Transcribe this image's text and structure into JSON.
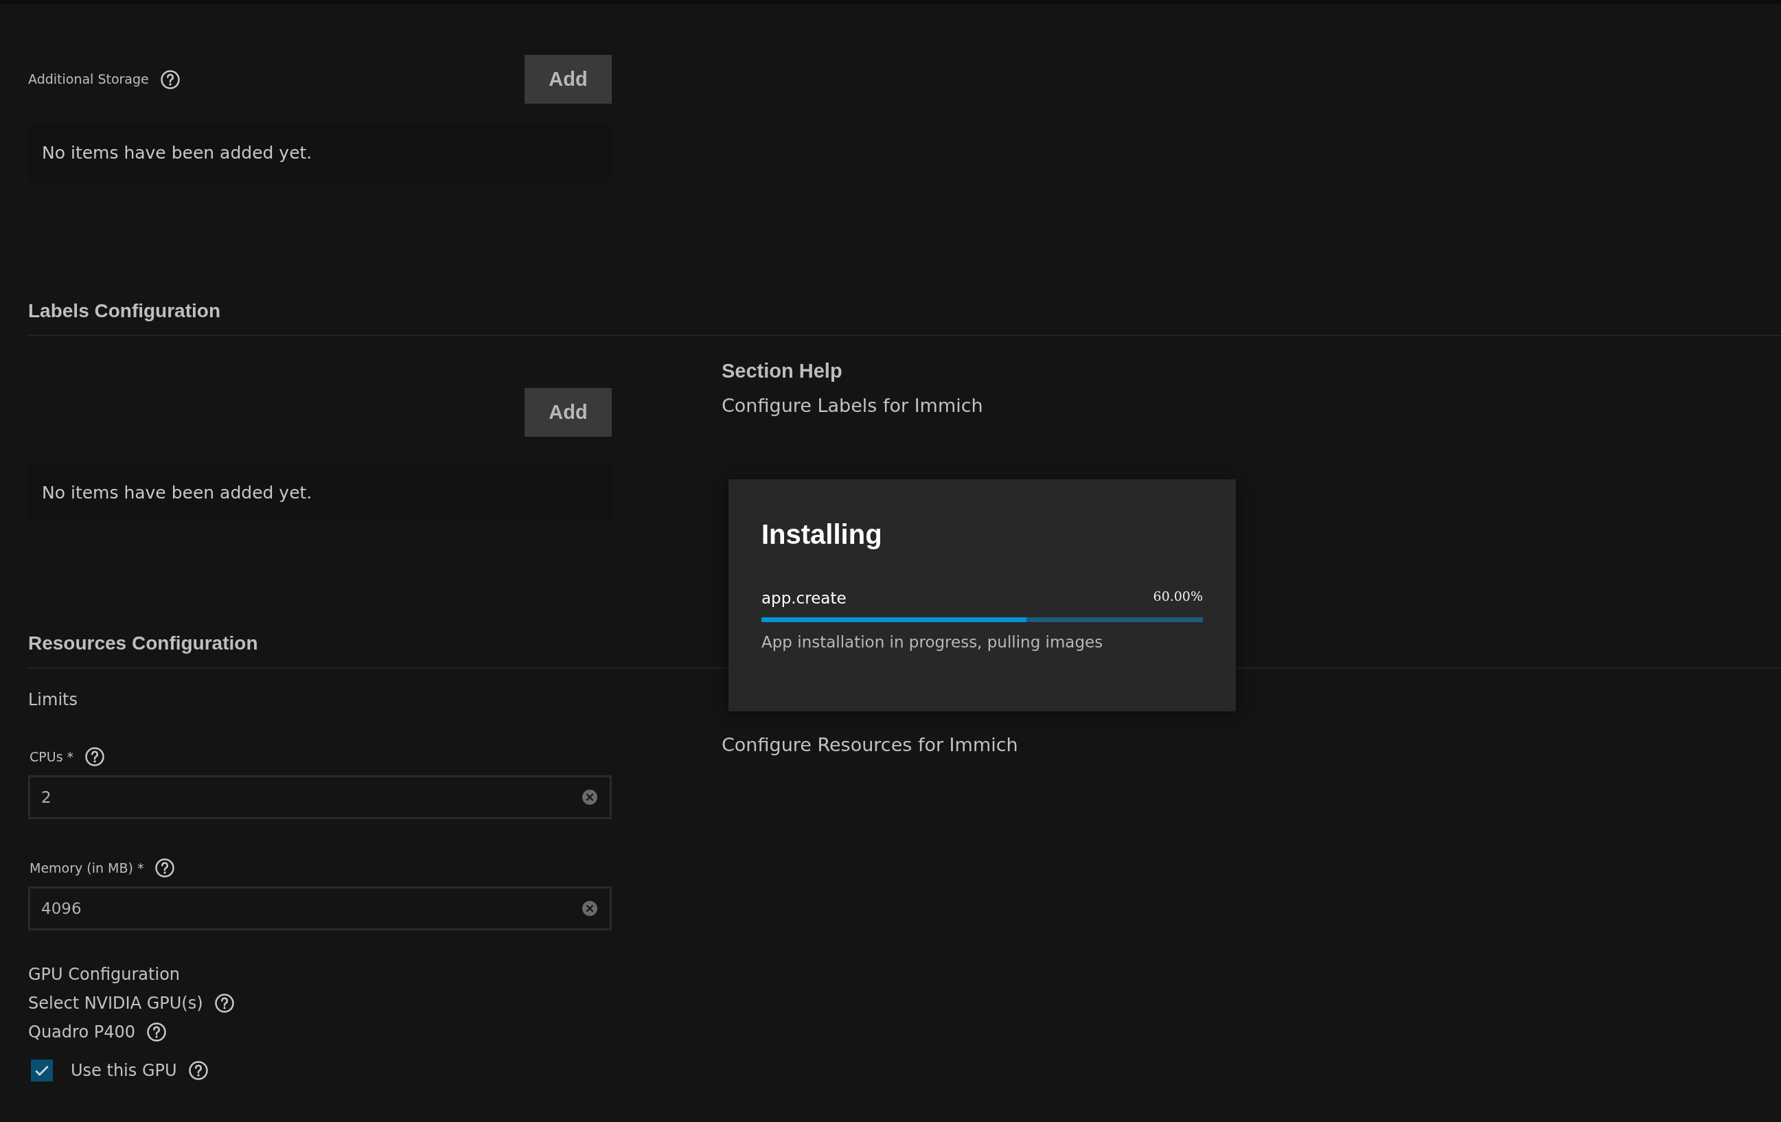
{
  "additional_storage": {
    "label": "Additional Storage",
    "button": "Add",
    "empty_text": "No items have been added yet."
  },
  "labels_configuration": {
    "title": "Labels Configuration",
    "button": "Add",
    "empty_text": "No items have been added yet.",
    "help_title": "Section Help",
    "help_text": "Configure Labels for Immich"
  },
  "resources_configuration": {
    "title": "Resources Configuration",
    "group_label": "Limits",
    "help_text": "Configure Resources for Immich",
    "fields": [
      {
        "label": "CPUs *",
        "value": "2"
      },
      {
        "label": "Memory (in MB) *",
        "value": "4096"
      }
    ],
    "gpu": {
      "title": "GPU Configuration",
      "select_label": "Select NVIDIA GPU(s)",
      "device": "Quadro P400",
      "checkbox": {
        "label": "Use this GPU",
        "checked": true
      }
    }
  },
  "dialog": {
    "title": "Installing",
    "job": "app.create",
    "percent": "60.00%",
    "level": 0.6,
    "message": "App installation in progress, pulling images"
  }
}
